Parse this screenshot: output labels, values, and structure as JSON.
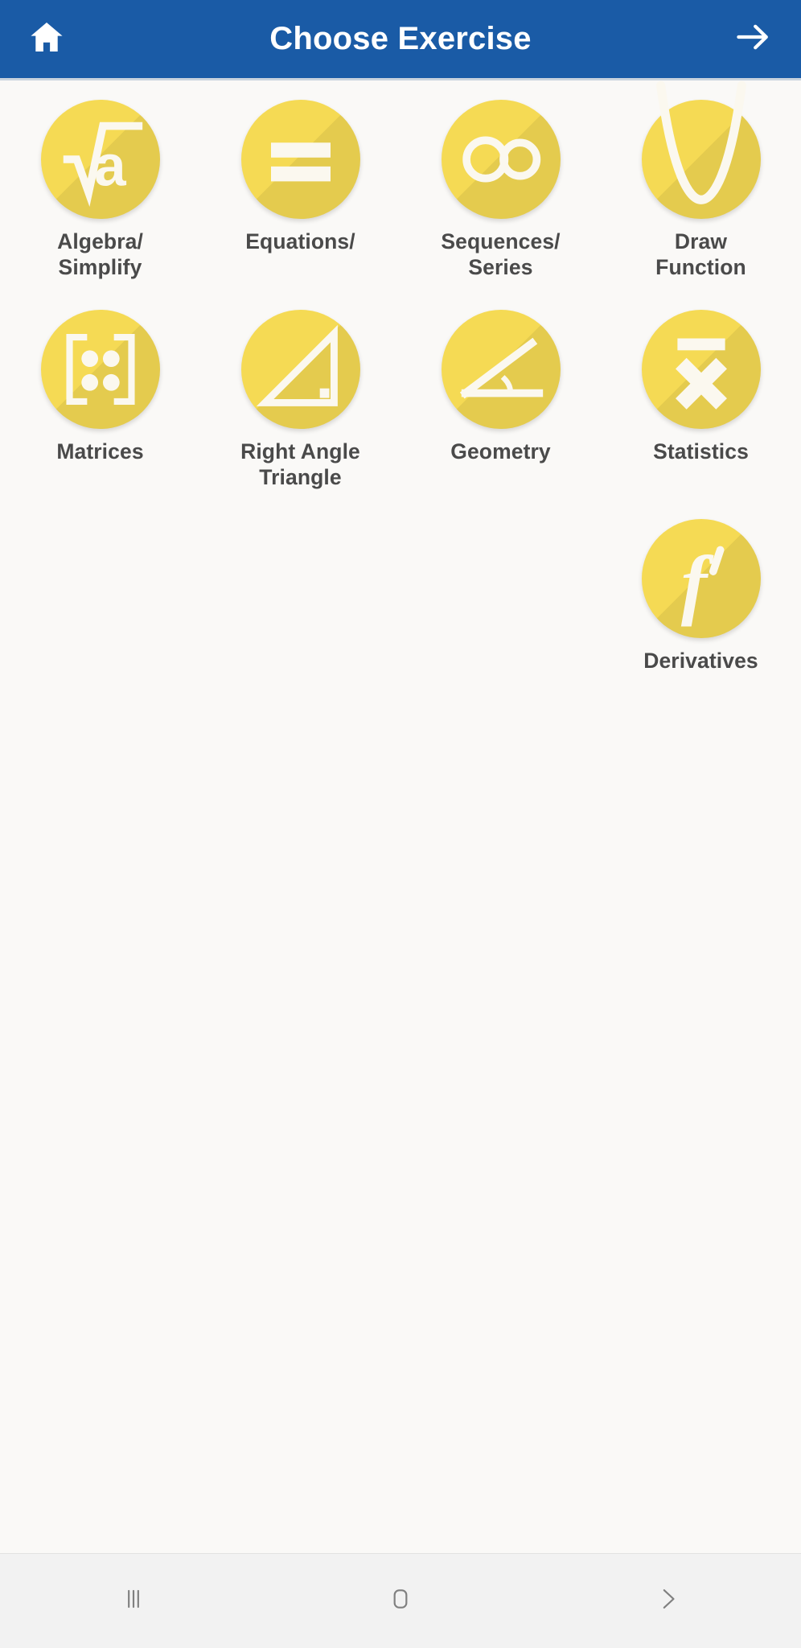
{
  "header": {
    "title": "Choose Exercise",
    "home_icon": "home-icon",
    "next_icon": "arrow-right-icon",
    "background_color": "#1a5ba6",
    "text_color": "#ffffff"
  },
  "theme": {
    "page_background": "#faf9f7",
    "icon_circle_color": "#f5da54",
    "icon_glyph_color": "#fbf8ef",
    "label_color": "#4a4a4a",
    "navbar_background": "#f2f2f2",
    "navbar_icon_color": "#808080"
  },
  "exercises": [
    {
      "label": "Algebra/\nSimplify",
      "label_line1": "Algebra/",
      "label_line2": "Simplify",
      "icon": "square-root-a-icon"
    },
    {
      "label": "Equations/",
      "label_line1": "Equations/",
      "label_line2": "",
      "icon": "equals-sign-icon"
    },
    {
      "label": "Sequences/\nSeries",
      "label_line1": "Sequences/",
      "label_line2": "Series",
      "icon": "infinity-icon"
    },
    {
      "label": "Draw\nFunction",
      "label_line1": "Draw",
      "label_line2": "Function",
      "icon": "parabola-curve-icon"
    },
    {
      "label": "Matrices",
      "label_line1": "Matrices",
      "label_line2": "",
      "icon": "matrix-brackets-icon"
    },
    {
      "label": "Right Angle\nTriangle",
      "label_line1": "Right Angle",
      "label_line2": "Triangle",
      "icon": "right-triangle-icon"
    },
    {
      "label": "Geometry",
      "label_line1": "Geometry",
      "label_line2": "",
      "icon": "angle-icon"
    },
    {
      "label": "Statistics",
      "label_line1": "Statistics",
      "label_line2": "",
      "icon": "x-bar-mean-icon"
    },
    {
      "label": "Derivatives",
      "label_line1": "Derivatives",
      "label_line2": "",
      "icon": "f-prime-icon"
    }
  ],
  "navbar": {
    "recent_label": "recent-apps",
    "home_label": "home",
    "back_label": "back"
  }
}
